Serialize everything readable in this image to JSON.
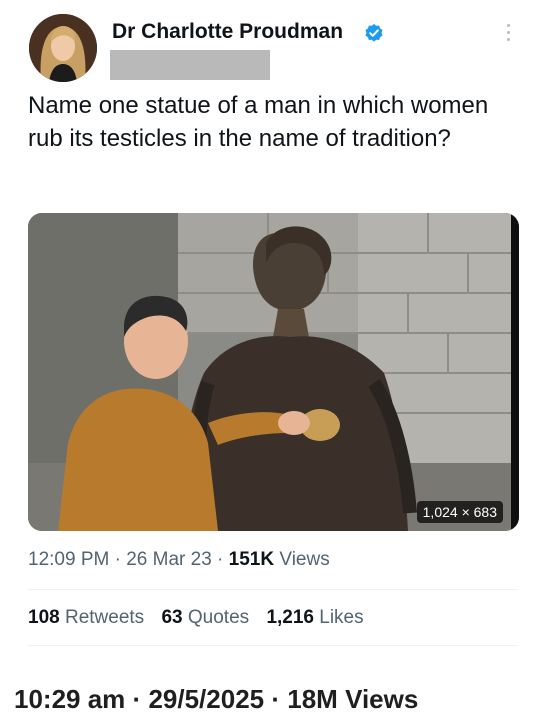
{
  "tweet": {
    "author_name": "Dr Charlotte Proudman",
    "text": "Name one statue of a man in which women rub its testicles in the name of tradition?",
    "media": {
      "dimensions_badge": "1,024 × 683"
    },
    "meta": {
      "time": "12:09 PM",
      "separator": "·",
      "date": "26 Mar 23",
      "views_count": "151K",
      "views_label": "Views"
    },
    "stats": {
      "retweets_count": "108",
      "retweets_label": "Retweets",
      "quotes_count": "63",
      "quotes_label": "Quotes",
      "likes_count": "1,216",
      "likes_label": "Likes"
    }
  },
  "footer": {
    "time": "10:29 am",
    "separator": "·",
    "date": "29/5/2025",
    "views_count": "18M",
    "views_label": "Views"
  },
  "colors": {
    "verified": "#1d9bf0",
    "text_primary": "#0f1419",
    "text_secondary": "#536471",
    "redaction": "#b9b9b9"
  },
  "icons": {
    "verified": "verified-badge-icon",
    "more": "more-options-icon"
  }
}
